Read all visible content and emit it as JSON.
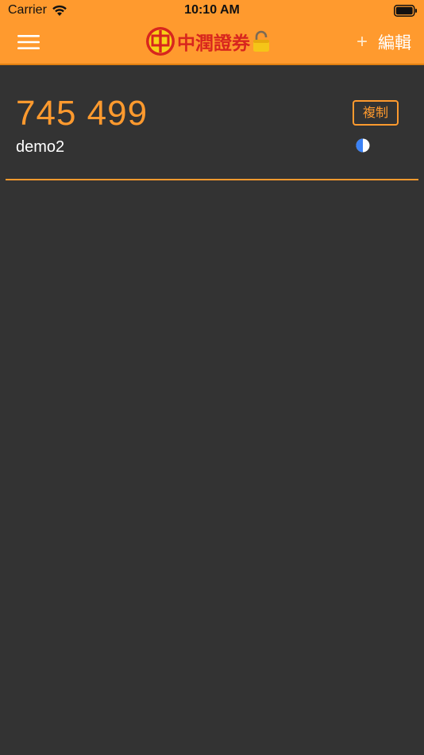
{
  "status_bar": {
    "carrier": "Carrier",
    "time": "10:10 AM"
  },
  "nav": {
    "menu_icon": "hamburger-menu-icon",
    "brand_name": "中潤證券",
    "brand_icon": "zhong-logo-icon",
    "lock_icon": "padlock-icon",
    "add_label": "+",
    "edit_label": "編輯"
  },
  "tokens": [
    {
      "code": "745 499",
      "account": "demo2",
      "copy_label": "複制",
      "timer_icon": "countdown-pie-icon"
    }
  ],
  "colors": {
    "header_bg": "#FF9A2E",
    "accent": "#FF9A2E",
    "background": "#333333",
    "brand_red": "#D8261E"
  }
}
